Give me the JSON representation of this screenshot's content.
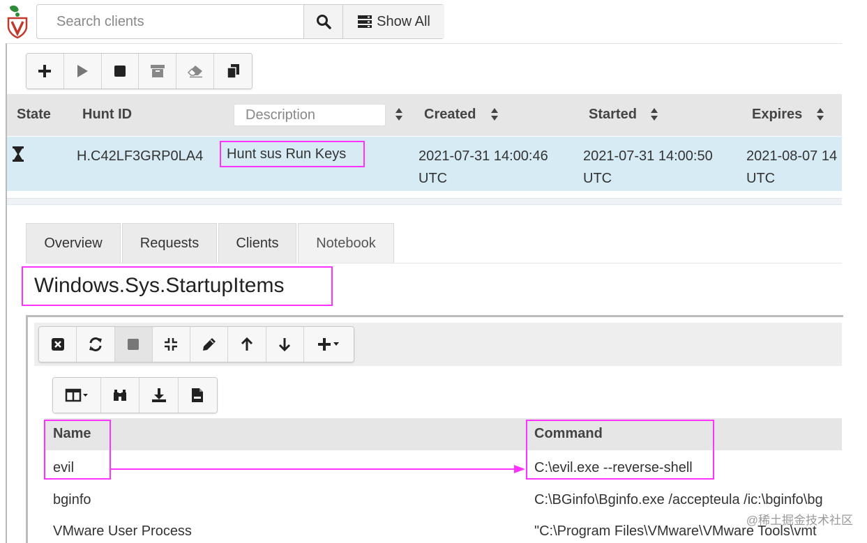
{
  "search": {
    "placeholder": "Search clients",
    "show_all_label": "Show All"
  },
  "hunts": {
    "columns": {
      "state": "State",
      "hunt_id": "Hunt ID",
      "description_placeholder": "Description",
      "created": "Created",
      "started": "Started",
      "expires": "Expires"
    },
    "rows": [
      {
        "hunt_id": "H.C42LF3GRP0LA4",
        "description": "Hunt sus Run Keys",
        "created_date": "2021-07-31 14:00:46",
        "created_tz": "UTC",
        "started_date": "2021-07-31 14:00:50",
        "started_tz": "UTC",
        "expires_date": "2021-08-07 14",
        "expires_tz": "UTC"
      }
    ]
  },
  "tabs": [
    "Overview",
    "Requests",
    "Clients",
    "Notebook"
  ],
  "notebook": {
    "title": "Windows.Sys.StartupItems"
  },
  "results": {
    "columns": {
      "name": "Name",
      "command": "Command"
    },
    "rows": [
      {
        "name": "evil",
        "command": "C:\\evil.exe --reverse-shell"
      },
      {
        "name": "bginfo",
        "command": "C:\\BGinfo\\Bginfo.exe /accepteula /ic:\\bginfo\\bg"
      },
      {
        "name": "VMware User Process",
        "command": "\"C:\\Program Files\\VMware\\VMware Tools\\vmt"
      }
    ]
  },
  "watermark": "@稀土掘金技术社区",
  "colors": {
    "highlight": "#ff33ff",
    "selected_row": "#d7ebf5",
    "header_bg": "#e6e6e6"
  }
}
